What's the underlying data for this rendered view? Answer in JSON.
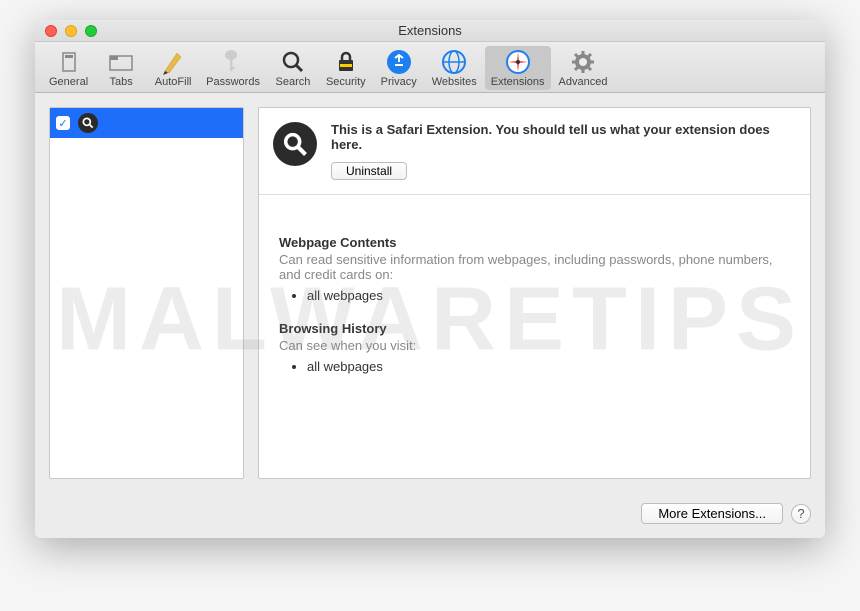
{
  "window": {
    "title": "Extensions"
  },
  "toolbar": {
    "items": [
      {
        "label": "General"
      },
      {
        "label": "Tabs"
      },
      {
        "label": "AutoFill"
      },
      {
        "label": "Passwords"
      },
      {
        "label": "Search"
      },
      {
        "label": "Security"
      },
      {
        "label": "Privacy"
      },
      {
        "label": "Websites"
      },
      {
        "label": "Extensions"
      },
      {
        "label": "Advanced"
      }
    ]
  },
  "detail": {
    "description": "This is a Safari Extension. You should tell us what your extension does here.",
    "uninstall": "Uninstall",
    "sections": [
      {
        "title": "Webpage Contents",
        "subtitle": "Can read sensitive information from webpages, including passwords, phone numbers, and credit cards on:",
        "items": [
          "all webpages"
        ]
      },
      {
        "title": "Browsing History",
        "subtitle": "Can see when you visit:",
        "items": [
          "all webpages"
        ]
      }
    ]
  },
  "footer": {
    "more": "More Extensions...",
    "help": "?"
  },
  "watermark": "MALWARETIPS"
}
